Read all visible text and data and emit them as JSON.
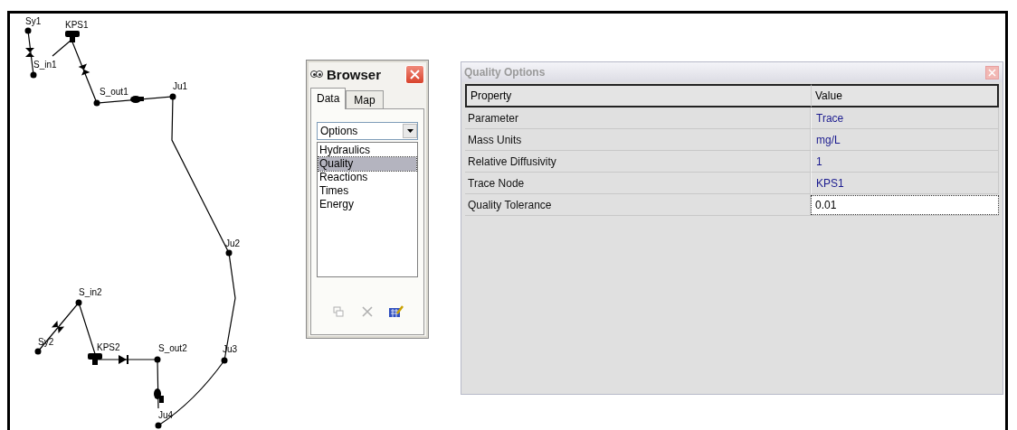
{
  "map": {
    "nodes": [
      {
        "label": "Sy1"
      },
      {
        "label": "KPS1"
      },
      {
        "label": "S_in1"
      },
      {
        "label": "S_out1"
      },
      {
        "label": "Ju1"
      },
      {
        "label": "Ju2"
      },
      {
        "label": "S_in2"
      },
      {
        "label": "Sy2"
      },
      {
        "label": "KPS2"
      },
      {
        "label": "S_out2"
      },
      {
        "label": "Ju3"
      },
      {
        "label": "Ju4"
      }
    ]
  },
  "browser": {
    "title": "Browser",
    "tabs": [
      {
        "label": "Data",
        "selected": true
      },
      {
        "label": "Map",
        "selected": false
      }
    ],
    "category": "Options",
    "items": [
      {
        "label": "Hydraulics",
        "selected": false
      },
      {
        "label": "Quality",
        "selected": true
      },
      {
        "label": "Reactions",
        "selected": false
      },
      {
        "label": "Times",
        "selected": false
      },
      {
        "label": "Energy",
        "selected": false
      }
    ],
    "tools": [
      {
        "kind": "add",
        "disabled": true
      },
      {
        "kind": "delete",
        "disabled": true
      },
      {
        "kind": "edit",
        "disabled": false
      }
    ]
  },
  "editor": {
    "title": "Quality Options",
    "columns": [
      "Property",
      "Value"
    ],
    "rows": [
      {
        "property": "Parameter",
        "value": "Trace",
        "selected": false
      },
      {
        "property": "Mass Units",
        "value": "mg/L",
        "selected": false
      },
      {
        "property": "Relative Diffusivity",
        "value": "1",
        "selected": false
      },
      {
        "property": "Trace Node",
        "value": "KPS1",
        "selected": false
      },
      {
        "property": "Quality Tolerance",
        "value": "0.01",
        "selected": true
      }
    ]
  }
}
